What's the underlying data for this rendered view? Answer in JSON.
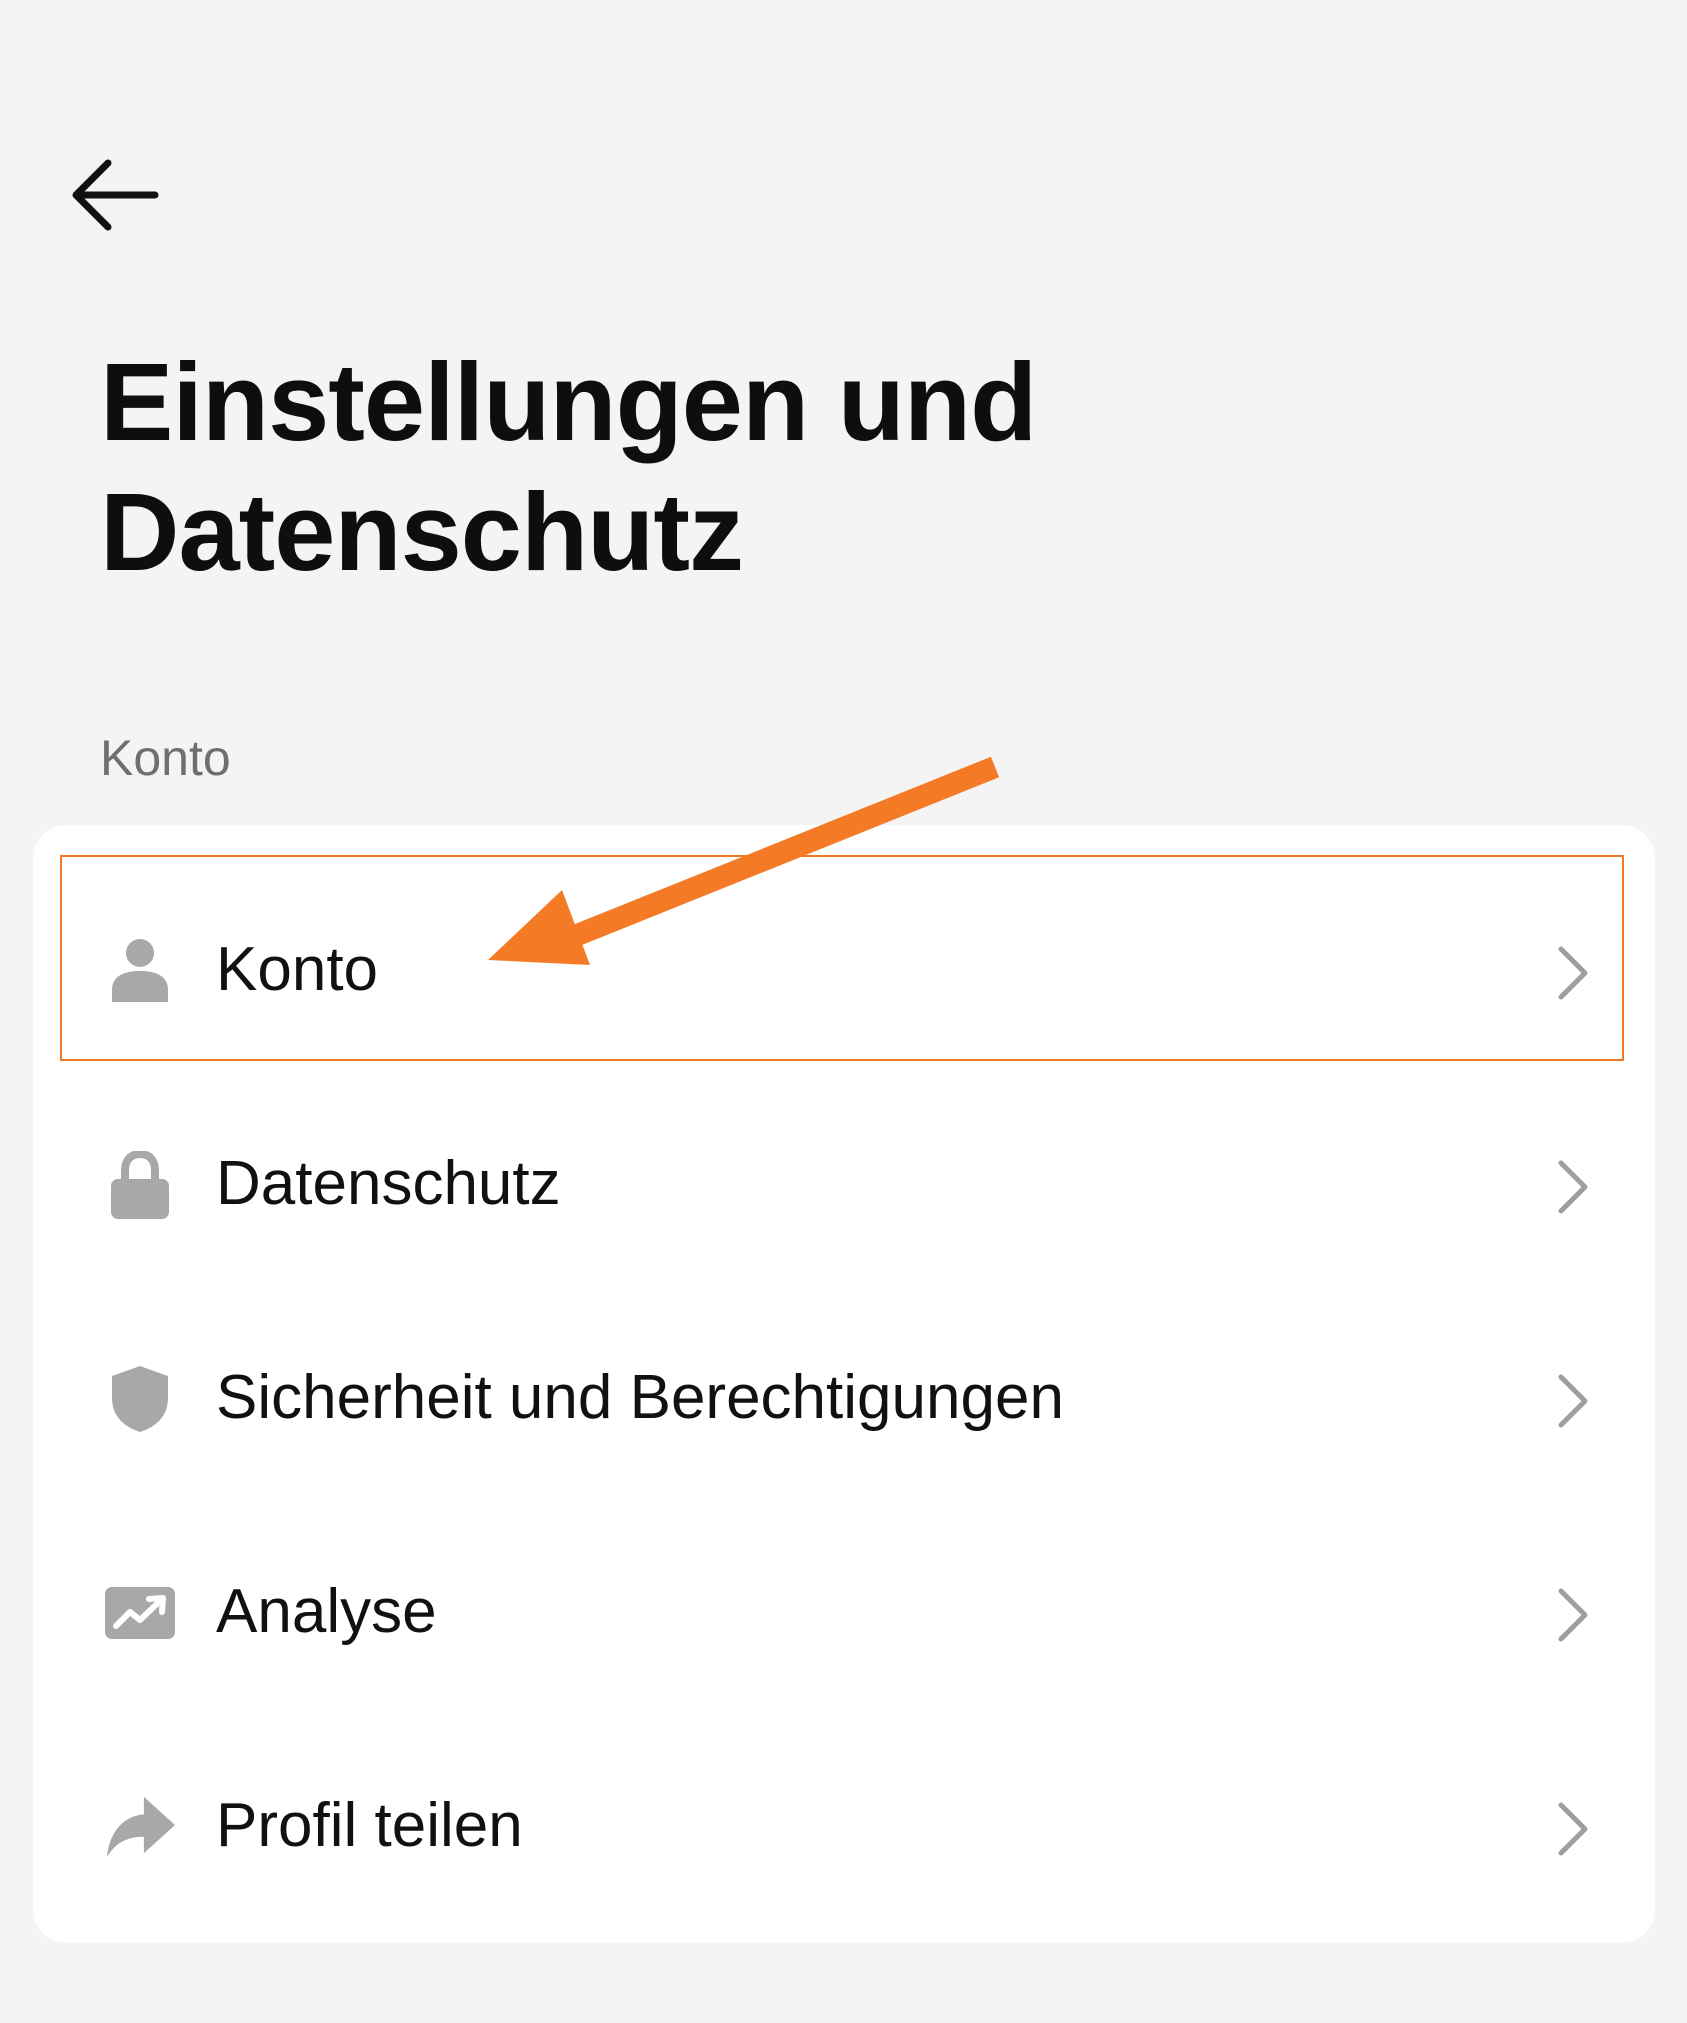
{
  "header": {
    "back_icon": "arrow-left-icon",
    "title": "Einstellungen und Datenschutz"
  },
  "section": {
    "label": "Konto"
  },
  "menu_items": [
    {
      "label": "Konto",
      "icon": "person-icon",
      "selected": true
    },
    {
      "label": "Datenschutz",
      "icon": "lock-icon",
      "selected": false
    },
    {
      "label": "Sicherheit und Berechtigungen",
      "icon": "shield-icon",
      "selected": false
    },
    {
      "label": "Analyse",
      "icon": "analytics-chart-icon",
      "selected": false
    },
    {
      "label": "Profil teilen",
      "icon": "share-arrow-icon",
      "selected": false
    }
  ],
  "colors": {
    "background": "#f4f4f4",
    "card": "#ffffff",
    "text": "#111111",
    "secondary_text": "#6f6f6f",
    "icon": "#a8a8a8",
    "highlight": "#f07a2a"
  }
}
